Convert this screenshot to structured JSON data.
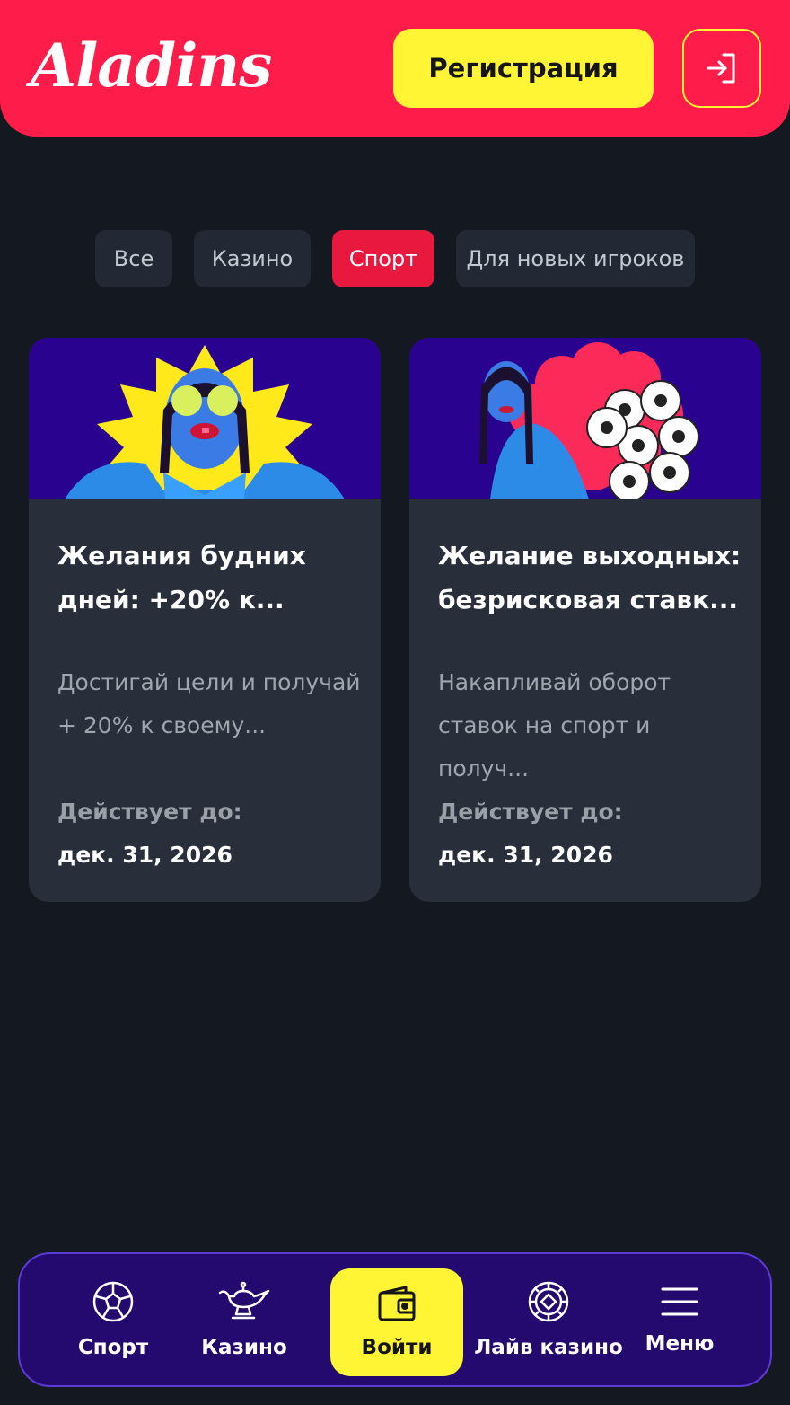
{
  "header": {
    "logo_text": "Aladins",
    "register_label": "Регистрация",
    "login_icon": "login-arrow-icon",
    "brand_color": "#fe1c4b",
    "accent_color": "#fff534"
  },
  "filters": [
    {
      "label": "Все",
      "active": false
    },
    {
      "label": "Казино",
      "active": false
    },
    {
      "label": "Спорт",
      "active": true
    },
    {
      "label": "Для новых игроков",
      "active": false
    }
  ],
  "promos": [
    {
      "title": "Желания будних дней: +20% к...",
      "description": "Достигай цели и получай + 20% к своему...",
      "valid_label": "Действует до:",
      "valid_date": "дек. 31, 2026"
    },
    {
      "title": "Желание выходных: безрисковая ставк...",
      "description": "Накапливай оборот ставок на спорт и получ...",
      "valid_label": "Действует до:",
      "valid_date": "дек. 31, 2026"
    }
  ],
  "bottom_nav": [
    {
      "label": "Спорт",
      "icon": "soccer-ball-icon",
      "active": false
    },
    {
      "label": "Казино",
      "icon": "magic-lamp-icon",
      "active": false
    },
    {
      "label": "Войти",
      "icon": "wallet-icon",
      "active": true
    },
    {
      "label": "Лайв казино",
      "icon": "roulette-chip-icon",
      "active": false
    },
    {
      "label": "Меню",
      "icon": "hamburger-menu-icon",
      "active": false
    }
  ]
}
